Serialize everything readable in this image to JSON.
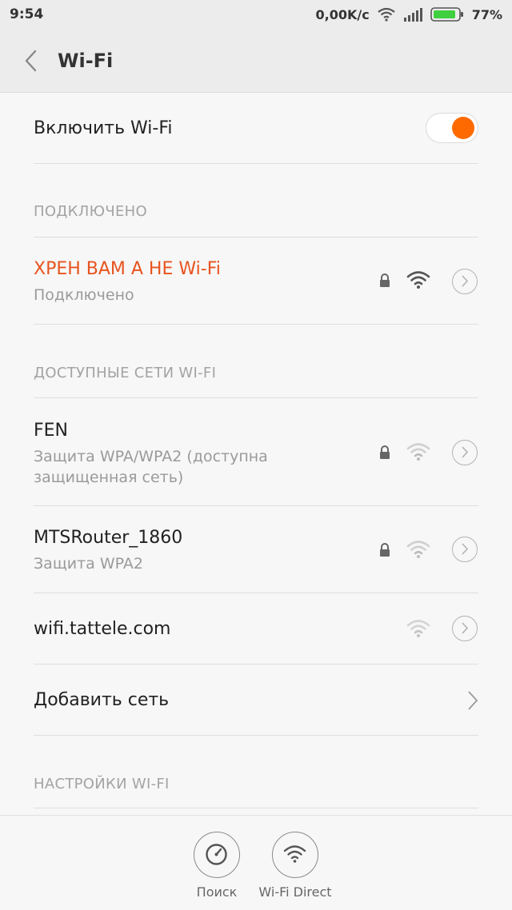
{
  "status_bar": {
    "time": "9:54",
    "net_speed": "0,00K/c",
    "battery": "77%",
    "icons": [
      "wifi-icon",
      "signal-icon",
      "battery-icon"
    ]
  },
  "header": {
    "title": "Wi-Fi",
    "back_icon": "chevron-left-icon"
  },
  "wifi_toggle": {
    "label": "Включить Wi-Fi",
    "on": true
  },
  "connected_section": {
    "title": "ПОДКЛЮЧЕНО",
    "network": {
      "name": "ХРЕН ВАМ А НЕ Wi-Fi",
      "status": "Подключено",
      "secured": true,
      "signal": "strong"
    }
  },
  "available_section": {
    "title": "ДОСТУПНЫЕ СЕТИ WI-FI",
    "networks": [
      {
        "name": "FEN",
        "status_line1": "Защита WPA/WPA2 (доступна",
        "status_line2": "защищенная сеть)",
        "secured": true,
        "signal": "weak"
      },
      {
        "name": "MTSRouter_1860",
        "status_line1": "Защита WPA2",
        "secured": true,
        "signal": "weak"
      },
      {
        "name": "wifi.tattele.com",
        "secured": false,
        "signal": "weak"
      }
    ],
    "add_network": "Добавить сеть"
  },
  "settings_section": {
    "title": "НАСТРОЙКИ WI-FI"
  },
  "bottom_bar": {
    "search_label": "Поиск",
    "direct_label": "Wi-Fi Direct"
  },
  "colors": {
    "accent": "#ff6a00",
    "connected_name": "#e8531f",
    "secondary_text": "#9a9a9a"
  }
}
